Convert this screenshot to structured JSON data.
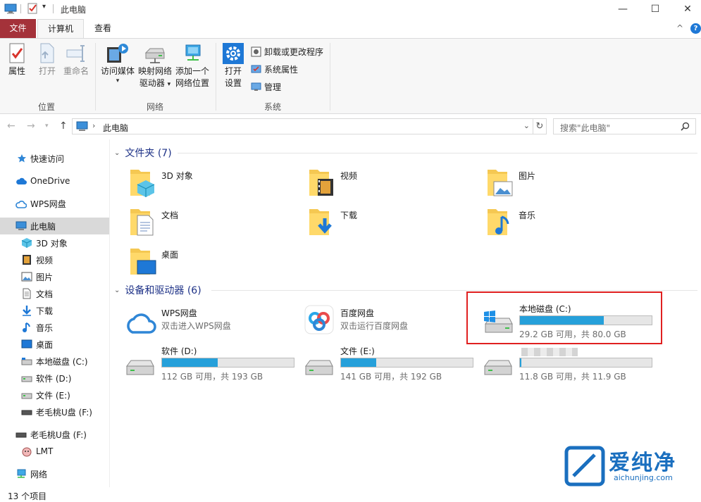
{
  "window": {
    "title": "此电脑",
    "minimize_glyph": "—",
    "maximize_glyph": "☐",
    "close_glyph": "✕"
  },
  "ribbon_tabs": {
    "file": "文件",
    "computer": "计算机",
    "view": "查看"
  },
  "ribbon_controls": {
    "collapse_glyph": "^",
    "help_glyph": "?"
  },
  "ribbon": {
    "location": {
      "label": "位置",
      "properties": "属性",
      "open": "打开",
      "rename": "重命名"
    },
    "network": {
      "label": "网络",
      "access_media": "访问媒体",
      "map_drive_1": "映射网络",
      "map_drive_2": "驱动器",
      "add_location_1": "添加一个",
      "add_location_2": "网络位置"
    },
    "system": {
      "label": "系统",
      "open_settings_1": "打开",
      "open_settings_2": "设置",
      "uninstall": "卸载或更改程序",
      "system_properties": "系统属性",
      "manage": "管理"
    }
  },
  "address": {
    "path": "此电脑",
    "search_placeholder": "搜索\"此电脑\""
  },
  "sidebar": {
    "items": [
      {
        "label": "快速访问",
        "icon": "star-icon"
      },
      {
        "label": "OneDrive",
        "icon": "cloud-icon"
      },
      {
        "label": "WPS网盘",
        "icon": "wps-cloud-icon"
      },
      {
        "label": "此电脑",
        "icon": "computer-icon"
      },
      {
        "label": "3D 对象",
        "icon": "cube-icon"
      },
      {
        "label": "视频",
        "icon": "video-icon"
      },
      {
        "label": "图片",
        "icon": "picture-icon"
      },
      {
        "label": "文档",
        "icon": "document-icon"
      },
      {
        "label": "下载",
        "icon": "download-icon"
      },
      {
        "label": "音乐",
        "icon": "music-icon"
      },
      {
        "label": "桌面",
        "icon": "desktop-icon"
      },
      {
        "label": "本地磁盘 (C:)",
        "icon": "drive-icon"
      },
      {
        "label": "软件 (D:)",
        "icon": "drive-icon"
      },
      {
        "label": "文件 (E:)",
        "icon": "drive-icon"
      },
      {
        "label": "老毛桃U盘 (F:)",
        "icon": "usb-drive-icon"
      },
      {
        "label": "老毛桃U盘 (F:)",
        "icon": "usb-drive-icon"
      },
      {
        "label": "LMT",
        "icon": "user-folder-icon"
      },
      {
        "label": "网络",
        "icon": "network-icon"
      }
    ]
  },
  "folders_section": {
    "title": "文件夹 (7)",
    "items": [
      {
        "name": "3D 对象",
        "icon": "folder-3d-icon"
      },
      {
        "name": "视频",
        "icon": "folder-video-icon"
      },
      {
        "name": "图片",
        "icon": "folder-picture-icon"
      },
      {
        "name": "文档",
        "icon": "folder-document-icon"
      },
      {
        "name": "下载",
        "icon": "folder-download-icon"
      },
      {
        "name": "音乐",
        "icon": "folder-music-icon"
      },
      {
        "name": "桌面",
        "icon": "folder-desktop-icon"
      }
    ]
  },
  "drives_section": {
    "title": "设备和驱动器 (6)",
    "wps": {
      "name": "WPS网盘",
      "desc": "双击进入WPS网盘"
    },
    "baidu": {
      "name": "百度网盘",
      "desc": "双击运行百度网盘"
    },
    "c": {
      "name": "本地磁盘 (C:)",
      "free": "29.2 GB 可用，共 80.0 GB",
      "used_fraction": 0.635
    },
    "d": {
      "name": "软件 (D:)",
      "free": "112 GB 可用，共 193 GB",
      "used_fraction": 0.42
    },
    "e": {
      "name": "文件 (E:)",
      "free": "141 GB 可用，共 192 GB",
      "used_fraction": 0.27
    },
    "f": {
      "free": "11.8 GB 可用，共 11.9 GB",
      "used_fraction": 0.01
    }
  },
  "status": {
    "item_count": "13 个项目"
  },
  "watermark": {
    "brand": "爱纯净",
    "url": "aichunjing.com"
  },
  "colors": {
    "file_tab": "#a4323a",
    "accent": "#26a0da",
    "highlight": "#e02020",
    "section_title": "#1e3287"
  }
}
